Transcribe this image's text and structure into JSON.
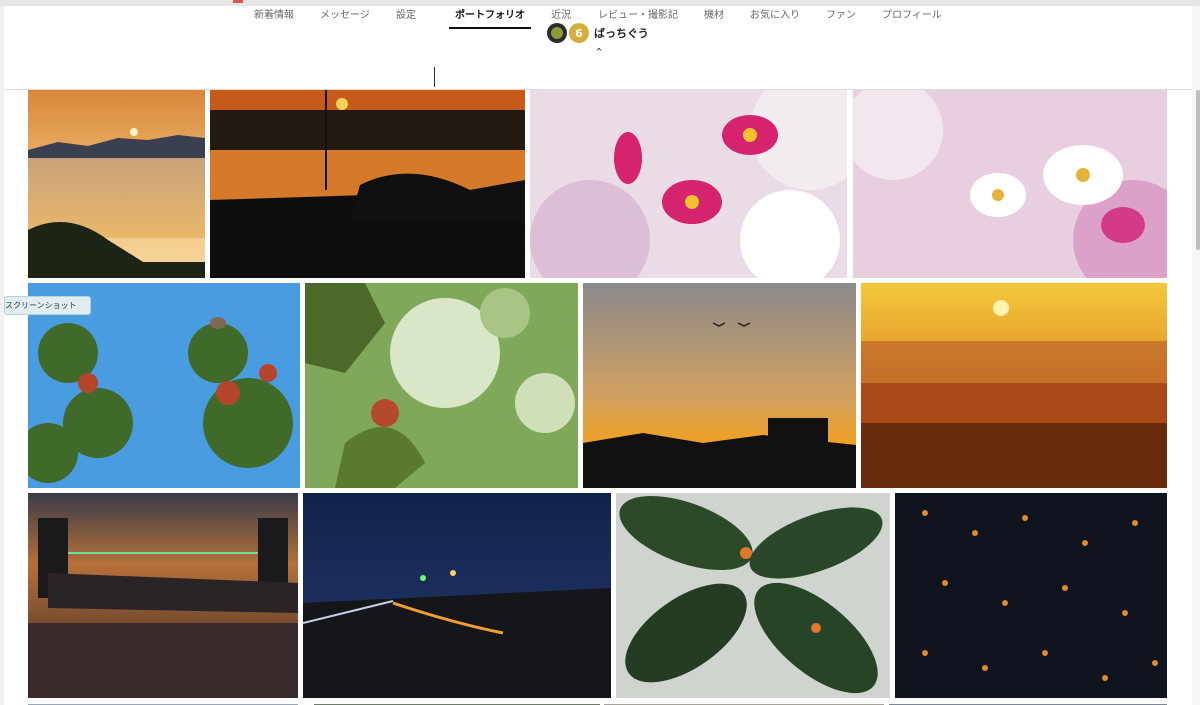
{
  "profile": {
    "username": "ばっちぐう",
    "badge_text": "6"
  },
  "nav": {
    "tabs": [
      {
        "label": "新着情報",
        "active": false
      },
      {
        "label": "メッセージ",
        "active": false
      },
      {
        "label": "設定",
        "active": false
      },
      {
        "label": "ポートフォリオ",
        "active": true
      },
      {
        "label": "近況",
        "active": false
      },
      {
        "label": "レビュー・撮影記",
        "active": false
      },
      {
        "label": "機材",
        "active": false
      },
      {
        "label": "お気に入り",
        "active": false
      },
      {
        "label": "ファン",
        "active": false
      },
      {
        "label": "プロフィール",
        "active": false
      }
    ]
  },
  "tooltip": {
    "text": "スクリーンショット"
  },
  "photos": [
    {
      "name": "photo-sunset-river-mountains",
      "scene": "sunset-lake"
    },
    {
      "name": "photo-sunset-reflection-pylon",
      "scene": "sunset-reflection"
    },
    {
      "name": "photo-pink-cosmos-flowers",
      "scene": "pink-cosmos"
    },
    {
      "name": "photo-white-cosmos-flowers",
      "scene": "white-cosmos"
    },
    {
      "name": "photo-bird-on-autumn-branches",
      "scene": "bird-branches"
    },
    {
      "name": "photo-autumn-leaves-bokeh",
      "scene": "leaves-bokeh"
    },
    {
      "name": "photo-sunset-silhouette-birds",
      "scene": "silhouette-sunset"
    },
    {
      "name": "photo-golden-field-sunset",
      "scene": "golden-field"
    },
    {
      "name": "photo-illuminated-bridge-night",
      "scene": "bridge-night"
    },
    {
      "name": "photo-night-road-lights",
      "scene": "night-road"
    },
    {
      "name": "photo-osmanthus-leaves",
      "scene": "osmanthus-leaves"
    },
    {
      "name": "photo-osmanthus-blossoms-ground",
      "scene": "osmanthus-ground"
    }
  ],
  "colors": {
    "active_tab": "#111111",
    "inactive_tab": "#666666",
    "badge": "#d4ad3b"
  }
}
